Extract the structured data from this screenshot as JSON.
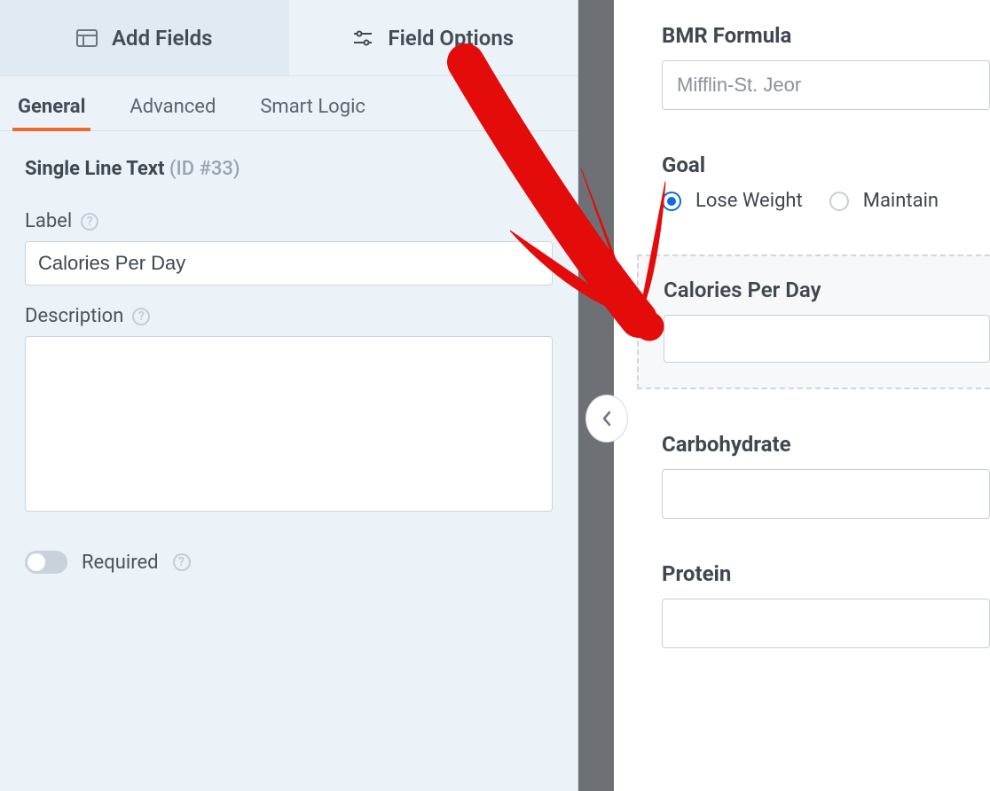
{
  "panelTabs": {
    "addFields": "Add Fields",
    "fieldOptions": "Field Options"
  },
  "subTabs": {
    "general": "General",
    "advanced": "Advanced",
    "smartLogic": "Smart Logic"
  },
  "fieldType": "Single Line Text",
  "fieldIdLabel": "(ID #33)",
  "settings": {
    "labelLabel": "Label",
    "labelValue": "Calories Per Day",
    "descriptionLabel": "Description",
    "descriptionValue": "",
    "requiredLabel": "Required"
  },
  "preview": {
    "bmrLabel": "BMR Formula",
    "bmrValue": "Mifflin-St. Jeor",
    "goalLabel": "Goal",
    "goalOptions": {
      "lose": "Lose Weight",
      "maintain": "Maintain"
    },
    "caloriesLabel": "Calories Per Day",
    "carbLabel": "Carbohydrate",
    "proteinLabel": "Protein"
  }
}
